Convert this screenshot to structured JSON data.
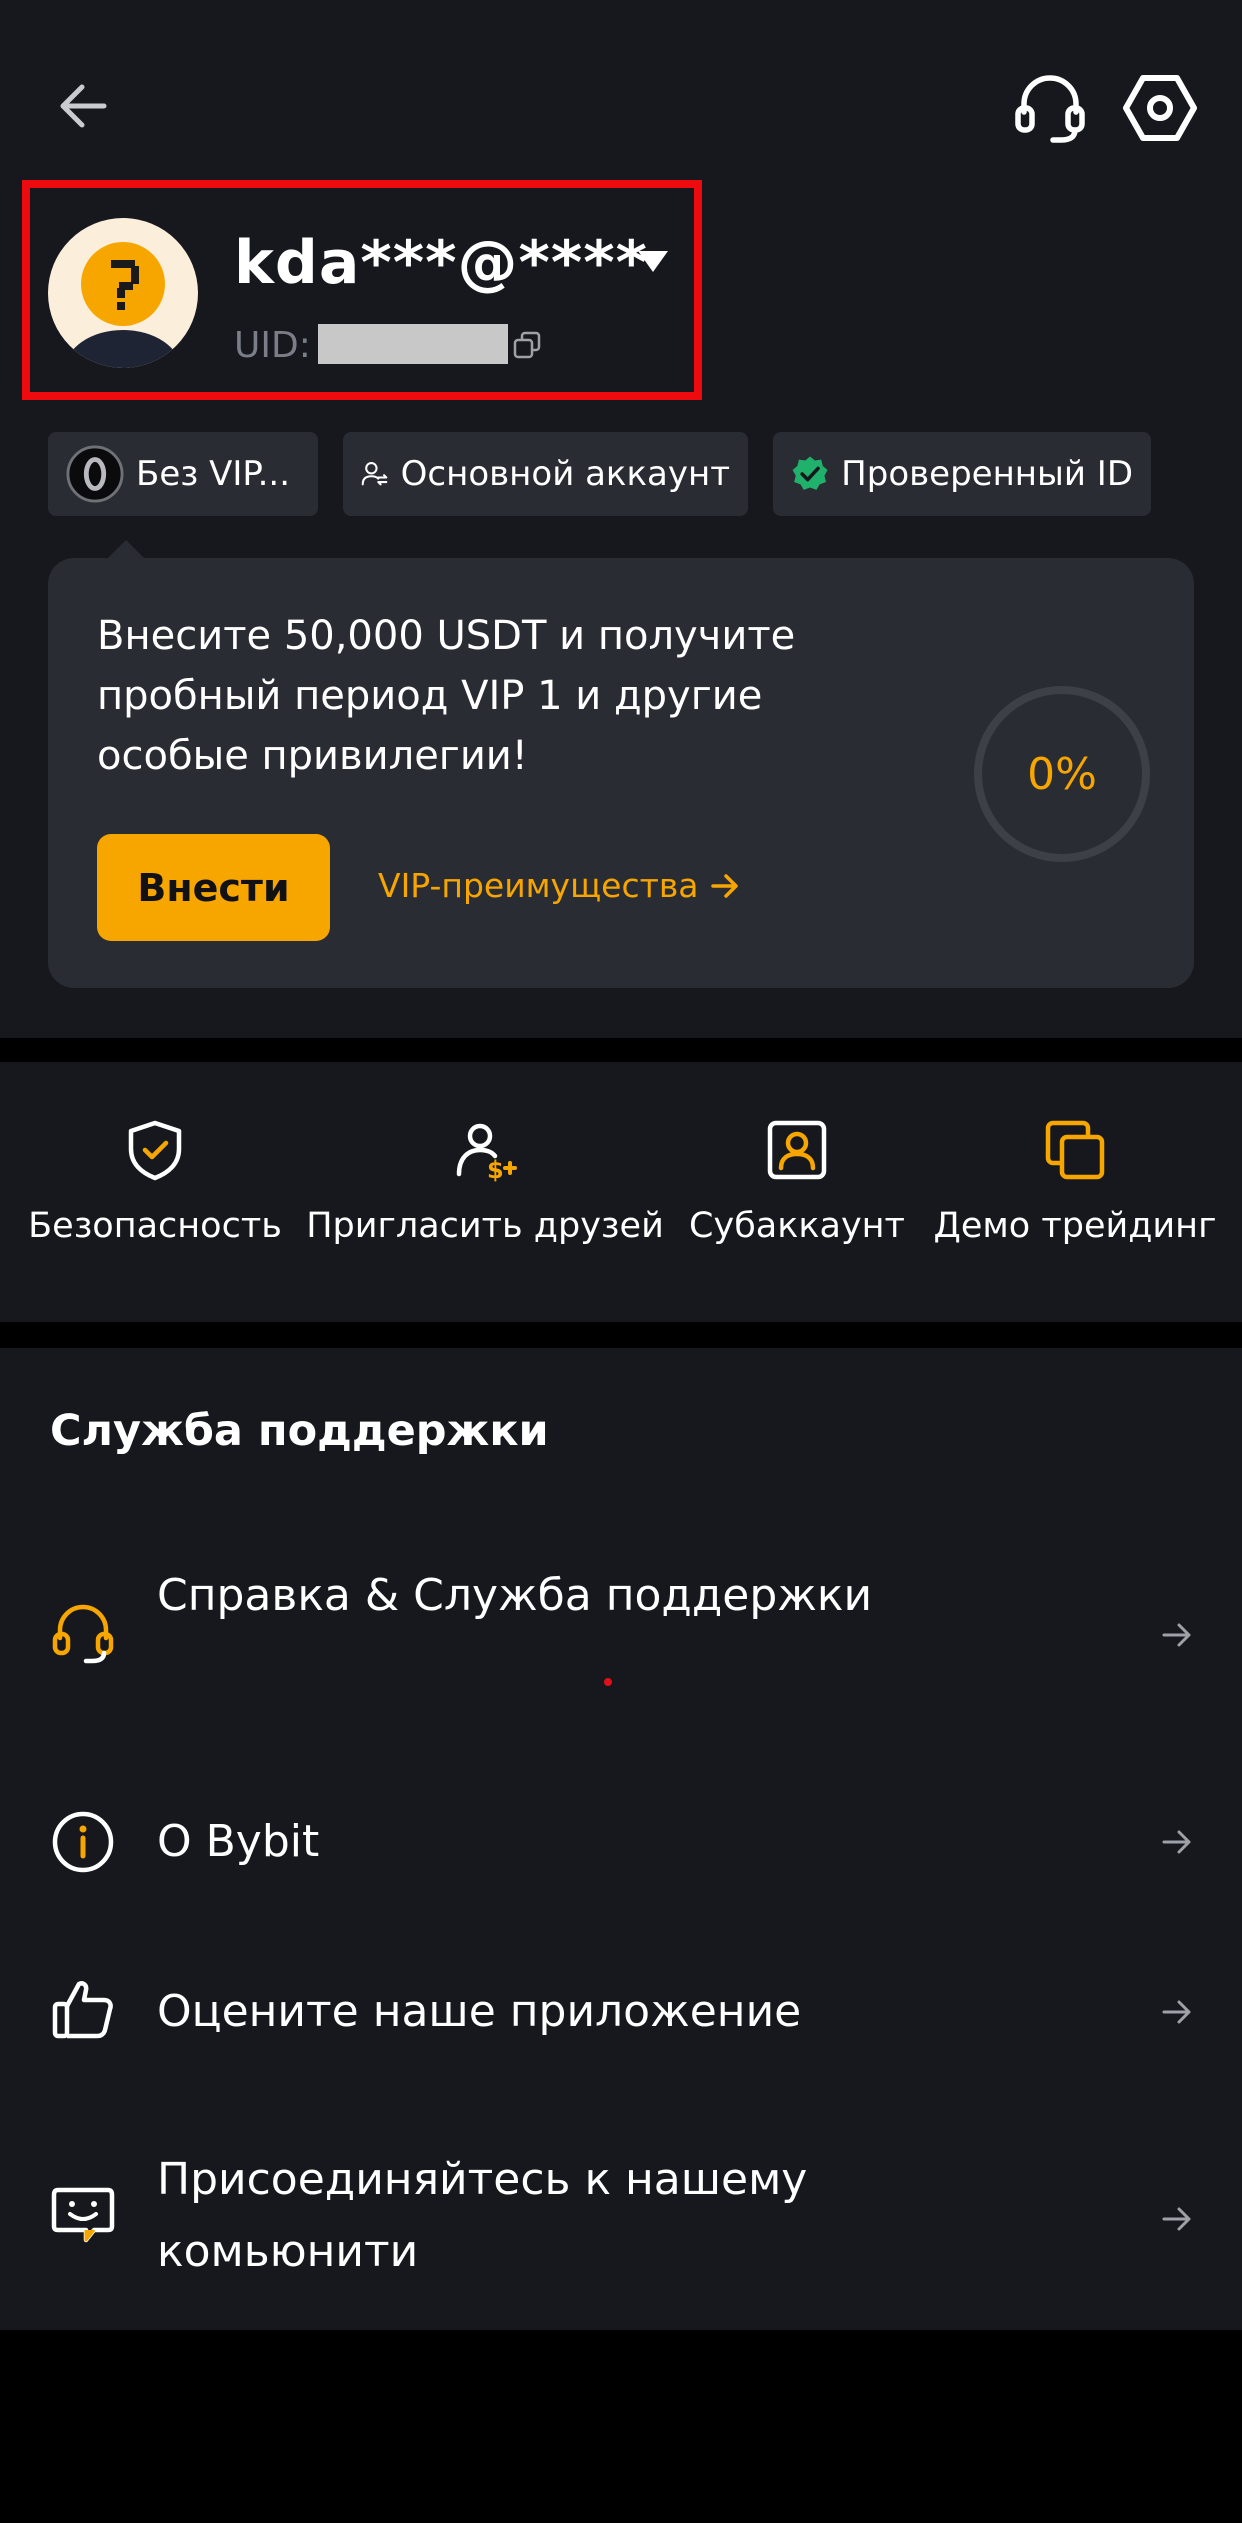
{
  "header": {
    "back_icon": "arrow-left-icon",
    "support_icon": "headset-icon",
    "settings_icon": "settings-hexagon-icon"
  },
  "profile": {
    "username": "kda***@****",
    "uid_label": "UID:",
    "avatar_icon": "question-mark-avatar"
  },
  "chips": {
    "vip": "Без VIP...",
    "account": "Основной аккаунт",
    "verified": "Проверенный ID"
  },
  "promo": {
    "text": "Внесите 50,000 USDT и получите пробный период VIP 1 и другие особые привилегии!",
    "deposit_label": "Внести",
    "vip_link_label": "VIP-преимущества",
    "progress_text": "0%",
    "progress": 0
  },
  "quick_actions": [
    {
      "label": "Безопасность",
      "icon": "shield-check-icon"
    },
    {
      "label": "Пригласить друзей",
      "icon": "user-dollar-icon"
    },
    {
      "label": "Субаккаунт",
      "icon": "user-square-icon"
    },
    {
      "label": "Демо трейдинг",
      "icon": "overlapping-squares-icon"
    }
  ],
  "support": {
    "title": "Служба поддержки",
    "items": [
      {
        "label": "Справка & Служба поддержки",
        "icon": "headset-icon"
      },
      {
        "label": "О Bybit",
        "icon": "info-icon"
      },
      {
        "label": "Оцените наше приложение",
        "icon": "thumbs-up-icon"
      },
      {
        "label": "Присоединяйтесь к нашему комьюнити",
        "icon": "chat-smile-icon"
      }
    ]
  },
  "colors": {
    "accent": "#f7a600",
    "highlight": "#ee0b10",
    "verified": "#20b26c",
    "background": "#17181e",
    "card": "#2a2c33"
  }
}
